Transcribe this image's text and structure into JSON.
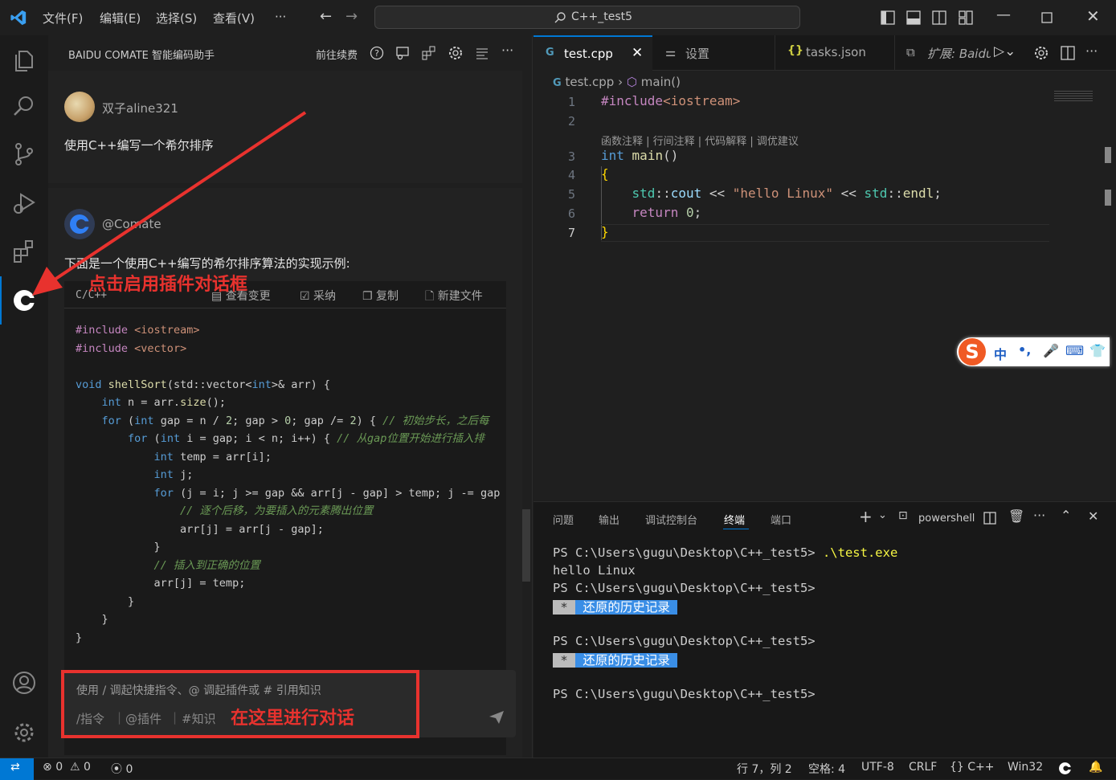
{
  "titlebar": {
    "menus": [
      "文件(F)",
      "编辑(E)",
      "选择(S)",
      "查看(V)",
      "···"
    ],
    "search": "C++_test5"
  },
  "sidebar": {
    "title": "BAIDU COMATE 智能编码助手",
    "renew": "前往续费",
    "user_name": "双子aline321",
    "user_msg": "使用C++编写一个希尔排序",
    "bot_name": "@Comate",
    "bot_msg": "下面是一个使用C++编写的希尔排序算法的实现示例:",
    "code_lang": "C/C++",
    "code_actions": [
      "查看变更",
      "采纳",
      "复制",
      "新建文件"
    ],
    "code_lines": [
      "#include <iostream>",
      "#include <vector>",
      "",
      "void shellSort(std::vector<int>& arr) {",
      "    int n = arr.size();",
      "    for (int gap = n / 2; gap > 0; gap /= 2) { // 初始步长，之后每",
      "        for (int i = gap; i < n; i++) { // 从gap位置开始进行插入排",
      "            int temp = arr[i];",
      "            int j;",
      "            for (j = i; j >= gap && arr[j - gap] > temp; j -= gap",
      "                // 逐个后移，为要插入的元素腾出位置",
      "                arr[j] = arr[j - gap];",
      "            }",
      "            // 插入到正确的位置",
      "            arr[j] = temp;",
      "        }",
      "    }",
      "}"
    ],
    "input_placeholder": "使用 / 调起快捷指令、@ 调起插件或 # 引用知识",
    "input_hints": [
      "/指令",
      "@插件",
      "#知识"
    ],
    "annotation_top": "点击启用插件对话框",
    "annotation_bottom": "在这里进行对话"
  },
  "tabs": {
    "active": "test.cpp",
    "settings": "设置",
    "tasks": "tasks.json",
    "ext": "扩展: Baidu"
  },
  "breadcrumb": {
    "file": "test.cpp",
    "symbol": "main()"
  },
  "editor": {
    "codelens": "函数注释 | 行间注释 | 代码解释 | 调优建议",
    "line_numbers": [
      "1",
      "2",
      "3",
      "4",
      "5",
      "6",
      "7"
    ]
  },
  "ime": {
    "label": "中"
  },
  "panel": {
    "tabs": [
      "问题",
      "输出",
      "调试控制台",
      "终端",
      "端口"
    ],
    "shell": "powershell",
    "lines": [
      "PS C:\\Users\\gugu\\Desktop\\C++_test5>",
      "hello Linux",
      "PS C:\\Users\\gugu\\Desktop\\C++_test5>",
      "PS C:\\Users\\gugu\\Desktop\\C++_test5>",
      "PS C:\\Users\\gugu\\Desktop\\C++_test5>"
    ],
    "cmd": ".\\test.exe",
    "restored_star": "*",
    "restored": "还原的历史记录"
  },
  "status": {
    "errors": "0",
    "warnings": "0",
    "ports": "0",
    "position": "行 7，列 2",
    "spaces": "空格: 4",
    "encoding": "UTF-8",
    "eol": "CRLF",
    "lang": "C++",
    "platform": "Win32"
  },
  "colors": {
    "accent": "#0078d4",
    "annotation": "#e8322e",
    "highlight": "#3a8ee6"
  }
}
